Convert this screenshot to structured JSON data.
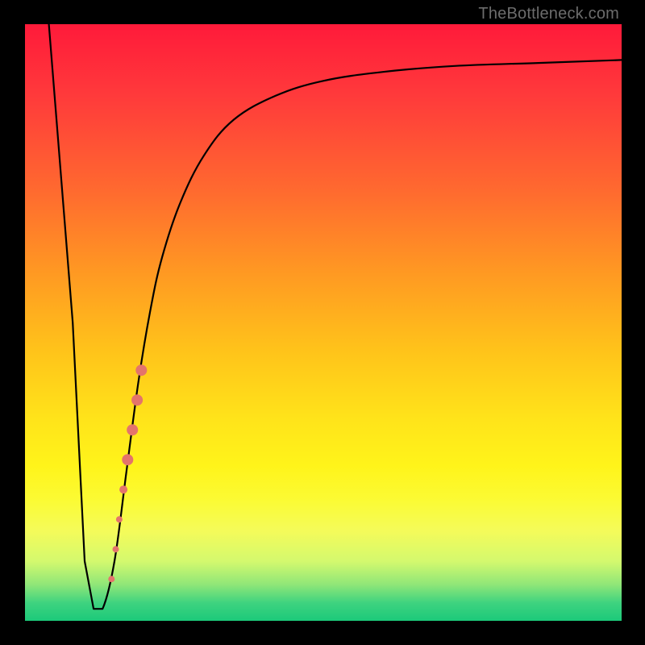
{
  "watermark": "TheBottleneck.com",
  "chart_data": {
    "type": "line",
    "title": "",
    "xlabel": "",
    "ylabel": "",
    "xlim": [
      0,
      100
    ],
    "ylim": [
      0,
      100
    ],
    "grid": false,
    "legend": false,
    "background_gradient": {
      "direction": "vertical",
      "stops": [
        {
          "pct": 0,
          "color": "#ff1a3a"
        },
        {
          "pct": 12,
          "color": "#ff3a3b"
        },
        {
          "pct": 28,
          "color": "#ff6a2f"
        },
        {
          "pct": 42,
          "color": "#ff9a22"
        },
        {
          "pct": 55,
          "color": "#ffc41a"
        },
        {
          "pct": 66,
          "color": "#ffe31a"
        },
        {
          "pct": 74,
          "color": "#fff41a"
        },
        {
          "pct": 80,
          "color": "#fbfb35"
        },
        {
          "pct": 85,
          "color": "#f4fb5a"
        },
        {
          "pct": 90,
          "color": "#d4f96e"
        },
        {
          "pct": 94,
          "color": "#8ee678"
        },
        {
          "pct": 97,
          "color": "#3ed37f"
        },
        {
          "pct": 100,
          "color": "#1cc97a"
        }
      ]
    },
    "series": [
      {
        "name": "bottleneck-curve",
        "x": [
          4.0,
          8.0,
          10.0,
          11.5,
          13.0,
          15.0,
          17.0,
          19.0,
          21.0,
          23.0,
          26.0,
          30.0,
          35.0,
          42.0,
          50.0,
          60.0,
          72.0,
          86.0,
          100.0
        ],
        "y": [
          100.0,
          50.0,
          10.0,
          2.0,
          2.0,
          10.0,
          25.0,
          40.0,
          52.0,
          61.0,
          70.0,
          78.0,
          84.0,
          88.0,
          90.5,
          92.0,
          93.0,
          93.5,
          94.0
        ]
      }
    ],
    "scatter_points": {
      "name": "highlight-dots",
      "color": "#e4746b",
      "points": [
        {
          "x": 14.5,
          "y": 7,
          "r": 4
        },
        {
          "x": 15.2,
          "y": 12,
          "r": 4
        },
        {
          "x": 15.8,
          "y": 17,
          "r": 4
        },
        {
          "x": 16.5,
          "y": 22,
          "r": 5
        },
        {
          "x": 17.2,
          "y": 27,
          "r": 7
        },
        {
          "x": 18.0,
          "y": 32,
          "r": 7
        },
        {
          "x": 18.8,
          "y": 37,
          "r": 7
        },
        {
          "x": 19.5,
          "y": 42,
          "r": 7
        }
      ]
    }
  }
}
